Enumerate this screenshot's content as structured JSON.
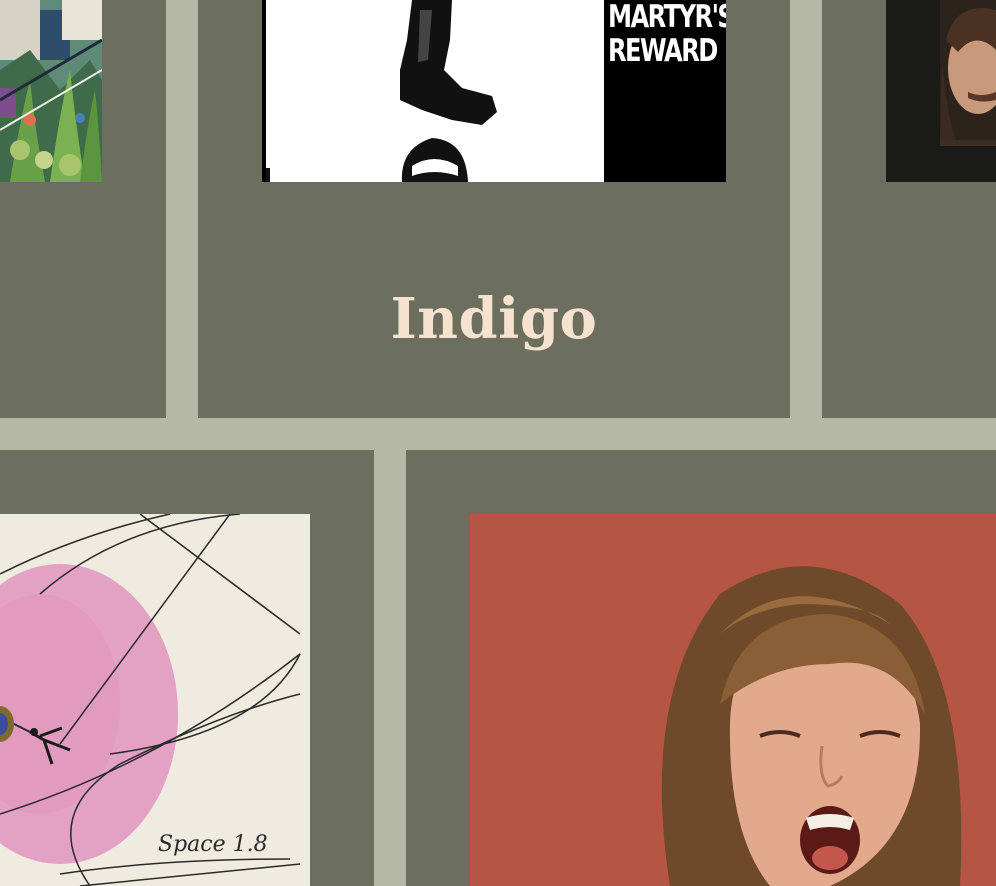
{
  "cards": [
    {
      "title": "",
      "cover": "botanical-collage-cover"
    },
    {
      "title": "Indigo",
      "cover": "martyrs-reward-cover",
      "cover_text": "MARTYR'S REWARD"
    },
    {
      "title": "",
      "cover": "portrait-photo-cover"
    },
    {
      "title": "",
      "cover": "space-1-8-cover",
      "cover_text": "Space 1.8"
    },
    {
      "title": "",
      "cover": "screaming-portrait-cover"
    }
  ],
  "colors": {
    "page_background": "#b5b8a5",
    "card_background": "#6c6f5e",
    "title_text": "#f6e3cf"
  }
}
